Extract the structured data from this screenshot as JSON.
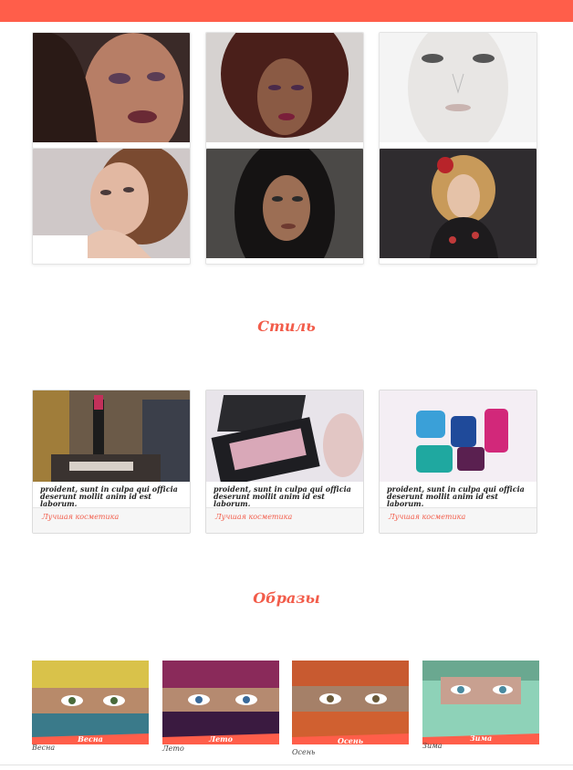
{
  "sections": {
    "style_title": "Стиль",
    "looks_title": "Образы"
  },
  "portraits": [
    {
      "name": "portrait-1"
    },
    {
      "name": "portrait-2"
    },
    {
      "name": "portrait-3"
    },
    {
      "name": "portrait-4"
    },
    {
      "name": "portrait-5"
    },
    {
      "name": "portrait-6"
    }
  ],
  "cosmetics": [
    {
      "text": "proident, sunt in culpa qui officia deserunt mollit anim id est laborum.",
      "link": "Лучшая косметика"
    },
    {
      "text": "proident, sunt in culpa qui officia deserunt mollit anim id est laborum.",
      "link": "Лучшая косметика"
    },
    {
      "text": "proident, sunt in culpa qui officia deserunt mollit anim id est laborum.",
      "link": "Лучшая косметика"
    }
  ],
  "seasons": [
    {
      "label": "Весна",
      "caption": "Весна"
    },
    {
      "label": "Лето",
      "caption": "Лето"
    },
    {
      "label": "Осень",
      "caption": "Осень"
    },
    {
      "label": "Зима",
      "caption": "Зима"
    }
  ],
  "colors": {
    "accent": "#ff5e4a",
    "title": "#f25c4a"
  }
}
